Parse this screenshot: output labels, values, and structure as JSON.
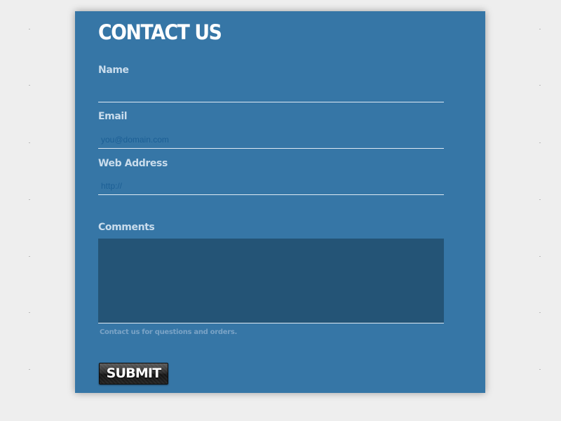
{
  "form": {
    "title": "CONTACT US",
    "name": {
      "label": "Name",
      "value": "",
      "placeholder": ""
    },
    "email": {
      "label": "Email",
      "value": "",
      "placeholder": "you@domain.com"
    },
    "web_address": {
      "label": "Web Address",
      "value": "",
      "placeholder": "http://"
    },
    "comments": {
      "label": "Comments",
      "value": ""
    },
    "hint": "Contact us for questions and orders.",
    "submit_label": "SUBMIT"
  },
  "colors": {
    "page_background": "#eeeeee",
    "panel_background": "#3676a6",
    "textarea_background": "#245476",
    "label_text": "#c9dcec",
    "title_text": "#ffffff",
    "field_underline": "#dfeaf4",
    "submit_button": "#1a1a1a"
  }
}
